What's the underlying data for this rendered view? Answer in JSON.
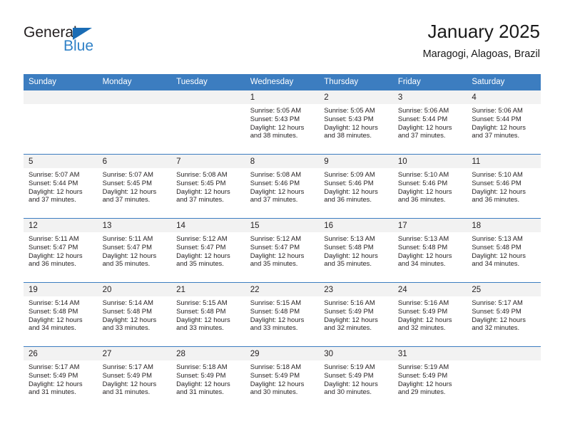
{
  "brand": {
    "name_part1": "General",
    "name_part2": "Blue",
    "triangle_icon": "triangle-icon",
    "accent_color": "#1a6cb5",
    "secondary_color": "#2f81c7"
  },
  "header": {
    "title": "January 2025",
    "location": "Maragogi, Alagoas, Brazil"
  },
  "calendar": {
    "header_bg": "#3c7dc0",
    "daynum_bg": "#f2f2f2",
    "weekdays": [
      "Sunday",
      "Monday",
      "Tuesday",
      "Wednesday",
      "Thursday",
      "Friday",
      "Saturday"
    ],
    "weeks": [
      [
        {
          "day": "",
          "sunrise": "",
          "sunset": "",
          "daylight1": "",
          "daylight2": "",
          "empty": true
        },
        {
          "day": "",
          "sunrise": "",
          "sunset": "",
          "daylight1": "",
          "daylight2": "",
          "empty": true
        },
        {
          "day": "",
          "sunrise": "",
          "sunset": "",
          "daylight1": "",
          "daylight2": "",
          "empty": true
        },
        {
          "day": "1",
          "sunrise": "Sunrise: 5:05 AM",
          "sunset": "Sunset: 5:43 PM",
          "daylight1": "Daylight: 12 hours",
          "daylight2": "and 38 minutes."
        },
        {
          "day": "2",
          "sunrise": "Sunrise: 5:05 AM",
          "sunset": "Sunset: 5:43 PM",
          "daylight1": "Daylight: 12 hours",
          "daylight2": "and 38 minutes."
        },
        {
          "day": "3",
          "sunrise": "Sunrise: 5:06 AM",
          "sunset": "Sunset: 5:44 PM",
          "daylight1": "Daylight: 12 hours",
          "daylight2": "and 37 minutes."
        },
        {
          "day": "4",
          "sunrise": "Sunrise: 5:06 AM",
          "sunset": "Sunset: 5:44 PM",
          "daylight1": "Daylight: 12 hours",
          "daylight2": "and 37 minutes."
        }
      ],
      [
        {
          "day": "5",
          "sunrise": "Sunrise: 5:07 AM",
          "sunset": "Sunset: 5:44 PM",
          "daylight1": "Daylight: 12 hours",
          "daylight2": "and 37 minutes."
        },
        {
          "day": "6",
          "sunrise": "Sunrise: 5:07 AM",
          "sunset": "Sunset: 5:45 PM",
          "daylight1": "Daylight: 12 hours",
          "daylight2": "and 37 minutes."
        },
        {
          "day": "7",
          "sunrise": "Sunrise: 5:08 AM",
          "sunset": "Sunset: 5:45 PM",
          "daylight1": "Daylight: 12 hours",
          "daylight2": "and 37 minutes."
        },
        {
          "day": "8",
          "sunrise": "Sunrise: 5:08 AM",
          "sunset": "Sunset: 5:46 PM",
          "daylight1": "Daylight: 12 hours",
          "daylight2": "and 37 minutes."
        },
        {
          "day": "9",
          "sunrise": "Sunrise: 5:09 AM",
          "sunset": "Sunset: 5:46 PM",
          "daylight1": "Daylight: 12 hours",
          "daylight2": "and 36 minutes."
        },
        {
          "day": "10",
          "sunrise": "Sunrise: 5:10 AM",
          "sunset": "Sunset: 5:46 PM",
          "daylight1": "Daylight: 12 hours",
          "daylight2": "and 36 minutes."
        },
        {
          "day": "11",
          "sunrise": "Sunrise: 5:10 AM",
          "sunset": "Sunset: 5:46 PM",
          "daylight1": "Daylight: 12 hours",
          "daylight2": "and 36 minutes."
        }
      ],
      [
        {
          "day": "12",
          "sunrise": "Sunrise: 5:11 AM",
          "sunset": "Sunset: 5:47 PM",
          "daylight1": "Daylight: 12 hours",
          "daylight2": "and 36 minutes."
        },
        {
          "day": "13",
          "sunrise": "Sunrise: 5:11 AM",
          "sunset": "Sunset: 5:47 PM",
          "daylight1": "Daylight: 12 hours",
          "daylight2": "and 35 minutes."
        },
        {
          "day": "14",
          "sunrise": "Sunrise: 5:12 AM",
          "sunset": "Sunset: 5:47 PM",
          "daylight1": "Daylight: 12 hours",
          "daylight2": "and 35 minutes."
        },
        {
          "day": "15",
          "sunrise": "Sunrise: 5:12 AM",
          "sunset": "Sunset: 5:47 PM",
          "daylight1": "Daylight: 12 hours",
          "daylight2": "and 35 minutes."
        },
        {
          "day": "16",
          "sunrise": "Sunrise: 5:13 AM",
          "sunset": "Sunset: 5:48 PM",
          "daylight1": "Daylight: 12 hours",
          "daylight2": "and 35 minutes."
        },
        {
          "day": "17",
          "sunrise": "Sunrise: 5:13 AM",
          "sunset": "Sunset: 5:48 PM",
          "daylight1": "Daylight: 12 hours",
          "daylight2": "and 34 minutes."
        },
        {
          "day": "18",
          "sunrise": "Sunrise: 5:13 AM",
          "sunset": "Sunset: 5:48 PM",
          "daylight1": "Daylight: 12 hours",
          "daylight2": "and 34 minutes."
        }
      ],
      [
        {
          "day": "19",
          "sunrise": "Sunrise: 5:14 AM",
          "sunset": "Sunset: 5:48 PM",
          "daylight1": "Daylight: 12 hours",
          "daylight2": "and 34 minutes."
        },
        {
          "day": "20",
          "sunrise": "Sunrise: 5:14 AM",
          "sunset": "Sunset: 5:48 PM",
          "daylight1": "Daylight: 12 hours",
          "daylight2": "and 33 minutes."
        },
        {
          "day": "21",
          "sunrise": "Sunrise: 5:15 AM",
          "sunset": "Sunset: 5:48 PM",
          "daylight1": "Daylight: 12 hours",
          "daylight2": "and 33 minutes."
        },
        {
          "day": "22",
          "sunrise": "Sunrise: 5:15 AM",
          "sunset": "Sunset: 5:48 PM",
          "daylight1": "Daylight: 12 hours",
          "daylight2": "and 33 minutes."
        },
        {
          "day": "23",
          "sunrise": "Sunrise: 5:16 AM",
          "sunset": "Sunset: 5:49 PM",
          "daylight1": "Daylight: 12 hours",
          "daylight2": "and 32 minutes."
        },
        {
          "day": "24",
          "sunrise": "Sunrise: 5:16 AM",
          "sunset": "Sunset: 5:49 PM",
          "daylight1": "Daylight: 12 hours",
          "daylight2": "and 32 minutes."
        },
        {
          "day": "25",
          "sunrise": "Sunrise: 5:17 AM",
          "sunset": "Sunset: 5:49 PM",
          "daylight1": "Daylight: 12 hours",
          "daylight2": "and 32 minutes."
        }
      ],
      [
        {
          "day": "26",
          "sunrise": "Sunrise: 5:17 AM",
          "sunset": "Sunset: 5:49 PM",
          "daylight1": "Daylight: 12 hours",
          "daylight2": "and 31 minutes."
        },
        {
          "day": "27",
          "sunrise": "Sunrise: 5:17 AM",
          "sunset": "Sunset: 5:49 PM",
          "daylight1": "Daylight: 12 hours",
          "daylight2": "and 31 minutes."
        },
        {
          "day": "28",
          "sunrise": "Sunrise: 5:18 AM",
          "sunset": "Sunset: 5:49 PM",
          "daylight1": "Daylight: 12 hours",
          "daylight2": "and 31 minutes."
        },
        {
          "day": "29",
          "sunrise": "Sunrise: 5:18 AM",
          "sunset": "Sunset: 5:49 PM",
          "daylight1": "Daylight: 12 hours",
          "daylight2": "and 30 minutes."
        },
        {
          "day": "30",
          "sunrise": "Sunrise: 5:19 AM",
          "sunset": "Sunset: 5:49 PM",
          "daylight1": "Daylight: 12 hours",
          "daylight2": "and 30 minutes."
        },
        {
          "day": "31",
          "sunrise": "Sunrise: 5:19 AM",
          "sunset": "Sunset: 5:49 PM",
          "daylight1": "Daylight: 12 hours",
          "daylight2": "and 29 minutes."
        },
        {
          "day": "",
          "sunrise": "",
          "sunset": "",
          "daylight1": "",
          "daylight2": "",
          "empty": true
        }
      ]
    ]
  }
}
